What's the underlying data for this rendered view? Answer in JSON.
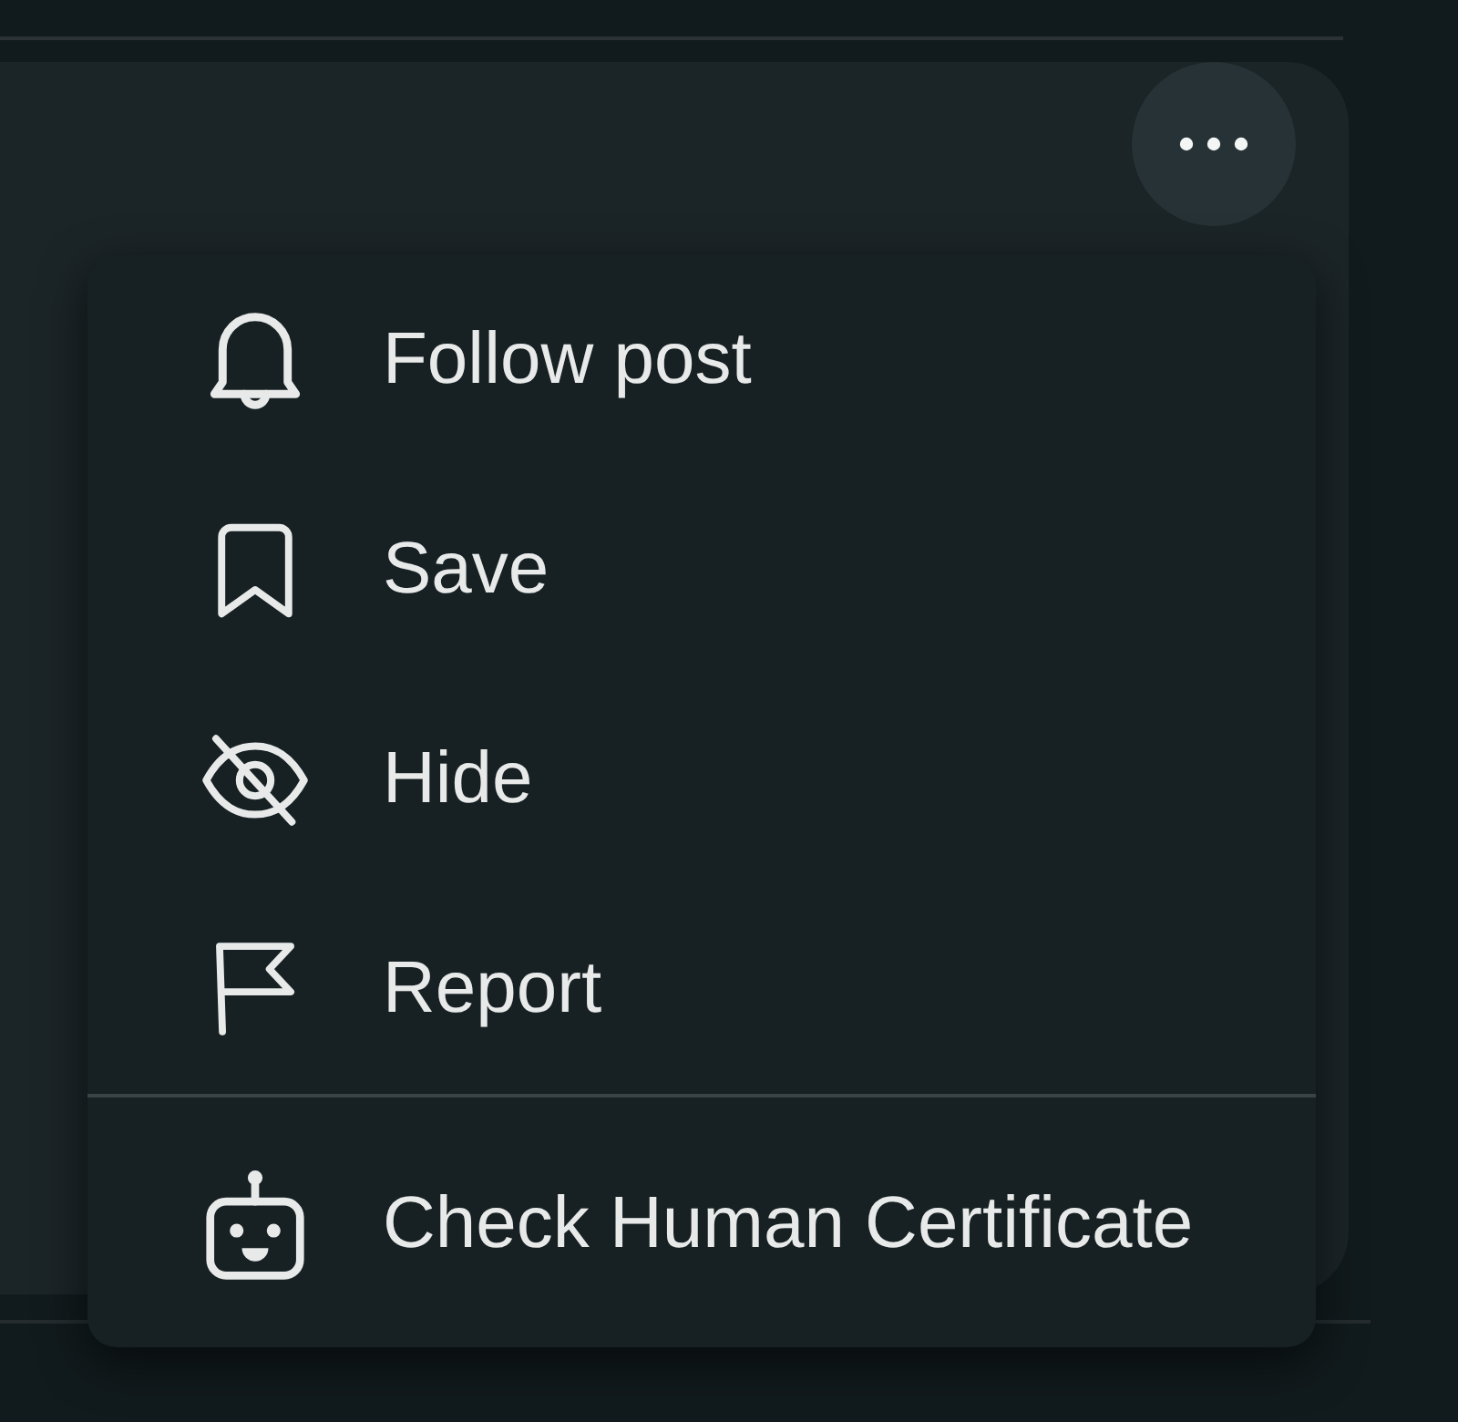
{
  "more_button": {
    "expanded": true
  },
  "menu": {
    "sections": [
      {
        "items": [
          {
            "label": "Follow post"
          },
          {
            "label": "Save"
          },
          {
            "label": "Hide"
          },
          {
            "label": "Report"
          }
        ]
      },
      {
        "items": [
          {
            "label": "Check Human Certificate"
          }
        ]
      }
    ]
  }
}
